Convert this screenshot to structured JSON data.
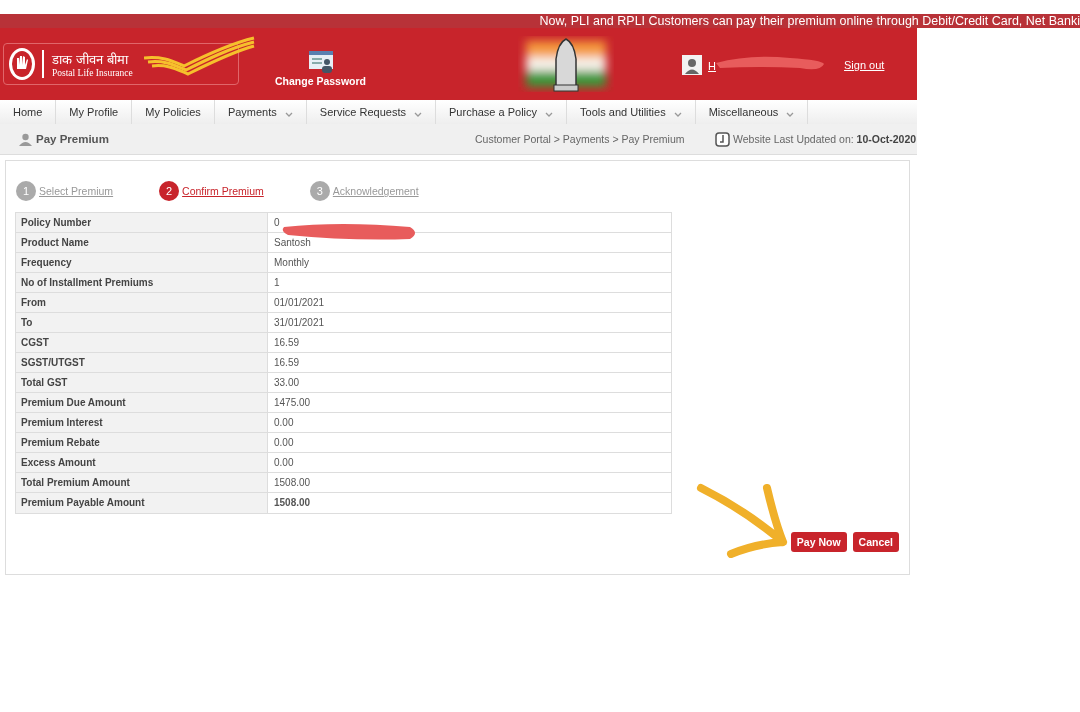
{
  "ticker": "Now, PLI and RPLI Customers can pay their premium online through Debit/Credit Card, Net Banki",
  "logo": {
    "hindi": "डाक जीवन बीमा",
    "english": "Postal Life Insurance"
  },
  "header": {
    "change_password": "Change Password",
    "greeting": "H",
    "greeting_redacted": true,
    "sign_out": "Sign out"
  },
  "nav": [
    {
      "label": "Home",
      "dropdown": false
    },
    {
      "label": "My Profile",
      "dropdown": false
    },
    {
      "label": "My Policies",
      "dropdown": false
    },
    {
      "label": "Payments",
      "dropdown": true
    },
    {
      "label": "Service Requests",
      "dropdown": true
    },
    {
      "label": "Purchase a Policy",
      "dropdown": true
    },
    {
      "label": "Tools and Utilities",
      "dropdown": true
    },
    {
      "label": "Miscellaneous",
      "dropdown": true
    }
  ],
  "subheader": {
    "title": "Pay Premium",
    "breadcrumb": "Customer Portal > Payments > Pay Premium",
    "updated_label": "Website Last Updated on:",
    "updated_date": "10-Oct-2020"
  },
  "steps": [
    {
      "number": "1",
      "label": "Select Premium",
      "selected": false
    },
    {
      "number": "2",
      "label": "Confirm Premium",
      "selected": true
    },
    {
      "number": "3",
      "label": "Acknowledgement",
      "selected": false
    }
  ],
  "table": {
    "rows": [
      {
        "label": "Policy Number",
        "value": "0",
        "redacted": true,
        "bold": false
      },
      {
        "label": "Product Name",
        "value": "Santosh",
        "redacted": false,
        "bold": false
      },
      {
        "label": "Frequency",
        "value": "Monthly",
        "redacted": false,
        "bold": false
      },
      {
        "label": "No of Installment Premiums",
        "value": "1",
        "redacted": false,
        "bold": false
      },
      {
        "label": "From",
        "value": "01/01/2021",
        "redacted": false,
        "bold": false
      },
      {
        "label": "To",
        "value": "31/01/2021",
        "redacted": false,
        "bold": false
      },
      {
        "label": "CGST",
        "value": "16.59",
        "redacted": false,
        "bold": false
      },
      {
        "label": "SGST/UTGST",
        "value": "16.59",
        "redacted": false,
        "bold": false
      },
      {
        "label": "Total GST",
        "value": "33.00",
        "redacted": false,
        "bold": false
      },
      {
        "label": "Premium Due Amount",
        "value": "1475.00",
        "redacted": false,
        "bold": false
      },
      {
        "label": "Premium Interest",
        "value": "0.00",
        "redacted": false,
        "bold": false
      },
      {
        "label": "Premium Rebate",
        "value": "0.00",
        "redacted": false,
        "bold": false
      },
      {
        "label": "Excess Amount",
        "value": "0.00",
        "redacted": false,
        "bold": false
      },
      {
        "label": "Total Premium Amount",
        "value": "1508.00",
        "redacted": false,
        "bold": false
      },
      {
        "label": "Premium Payable Amount",
        "value": "1508.00",
        "redacted": false,
        "bold": true
      }
    ]
  },
  "buttons": [
    "Pay Now",
    "Cancel"
  ]
}
